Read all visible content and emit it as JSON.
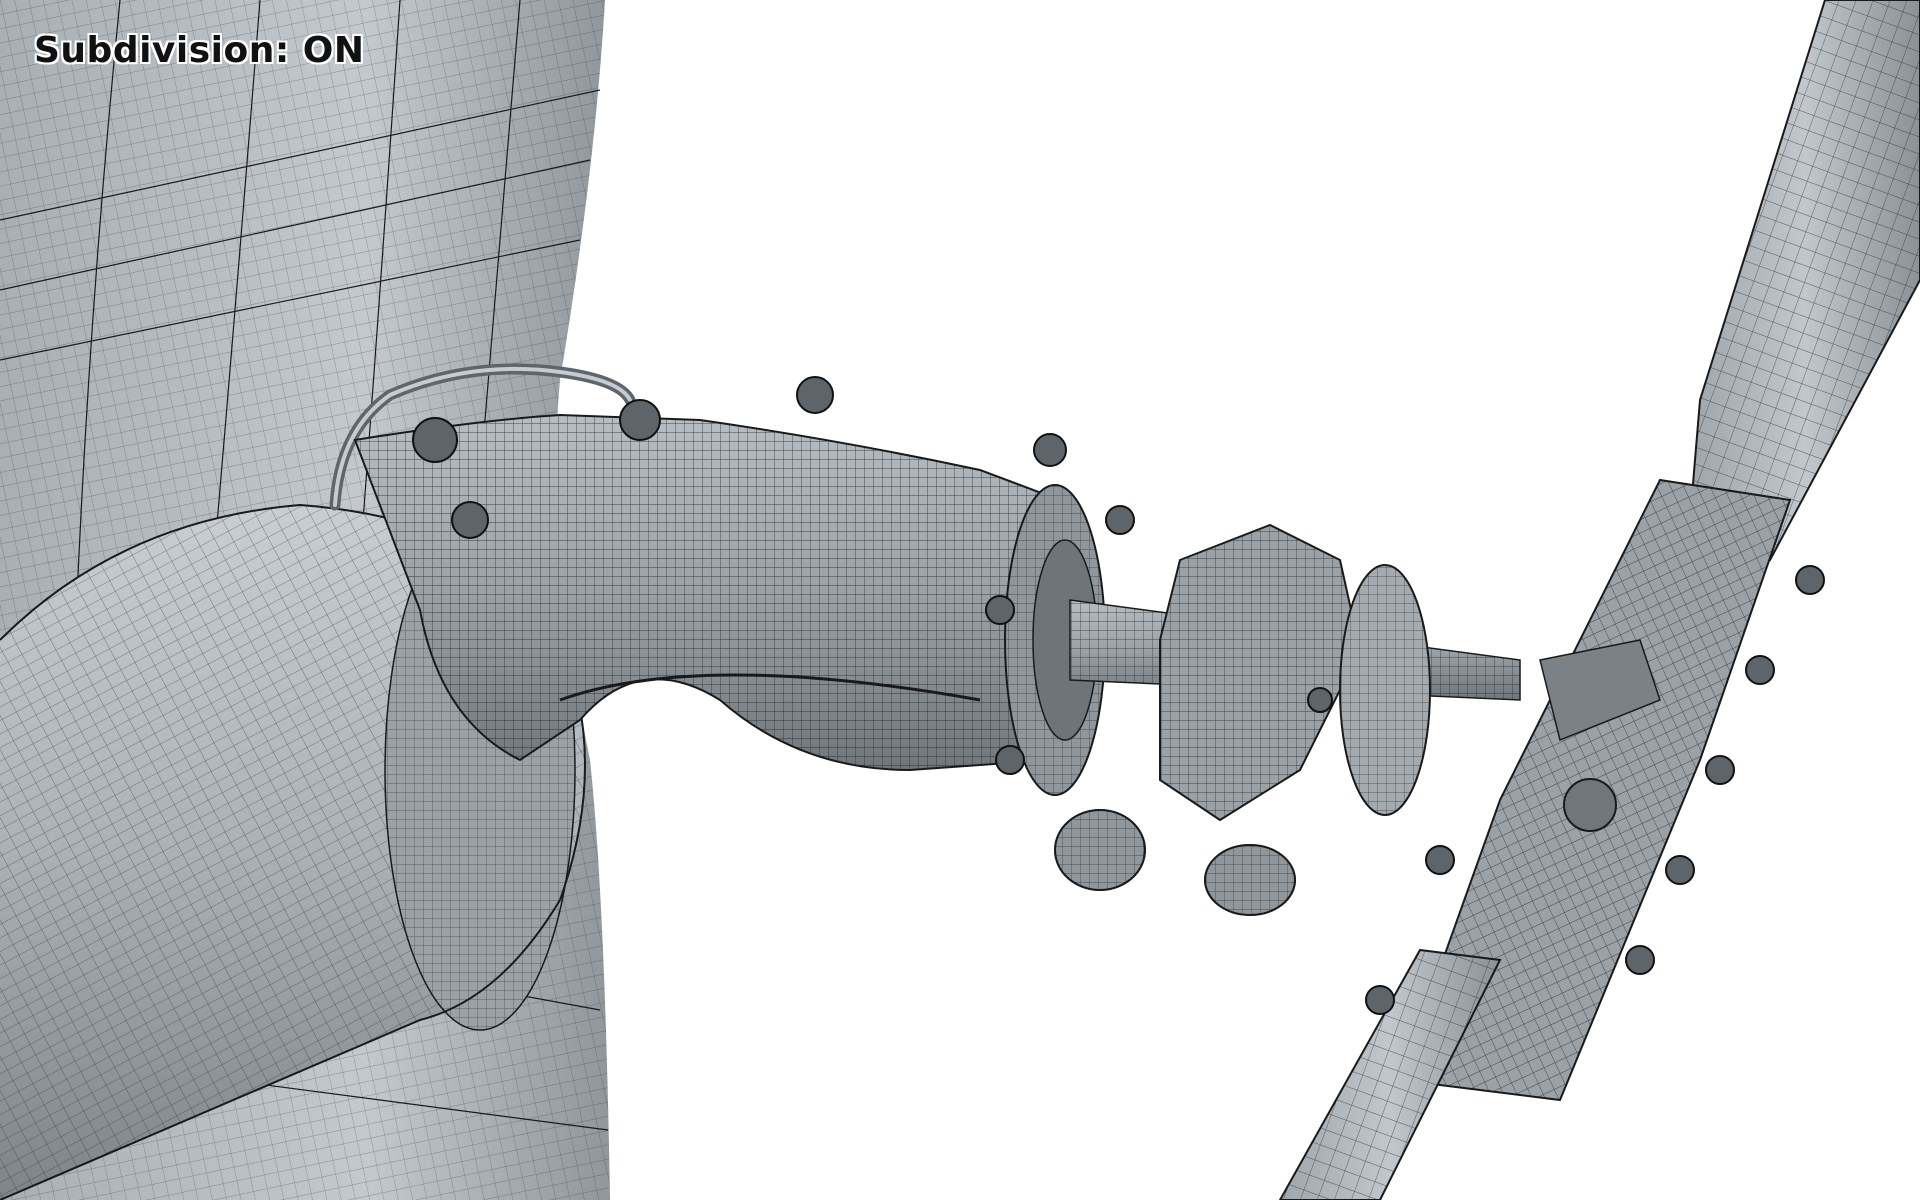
{
  "viewport": {
    "overlay_label": "Subdivision: ON"
  },
  "colors": {
    "background": "#ffffff",
    "mesh_fill_light": "#b9c0c6",
    "mesh_fill_mid": "#8f979d",
    "mesh_fill_dark": "#5f666b",
    "wire": "#1a1a1a",
    "label_text": "#111111"
  },
  "icons": [
    "wireframe-mesh"
  ]
}
